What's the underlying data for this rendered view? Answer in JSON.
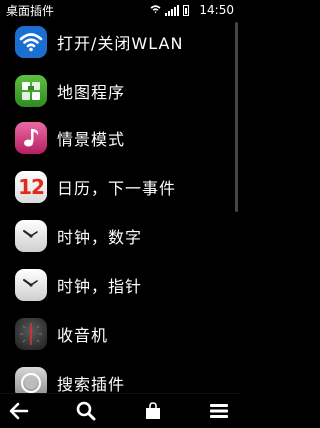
{
  "status": {
    "title": "桌面插件",
    "time": "14:50",
    "wifi_icon": "wifi-icon",
    "signal_icon": "signal-icon",
    "battery_icon": "battery-icon"
  },
  "items": [
    {
      "label": "打开/关闭WLAN",
      "icon": "wlan-icon",
      "color": "#1b6fd1"
    },
    {
      "label": "地图程序",
      "icon": "maps-icon",
      "color": "#3c9a2c"
    },
    {
      "label": "情景模式",
      "icon": "profile-music-icon",
      "color": "#c2306e"
    },
    {
      "label": "日历，下一事件",
      "icon": "calendar-icon",
      "color": "#e03a2a"
    },
    {
      "label": "时钟，数字",
      "icon": "clock-icon",
      "color": "#e8e8e8"
    },
    {
      "label": "时钟，指针",
      "icon": "clock-icon",
      "color": "#e8e8e8"
    },
    {
      "label": "收音机",
      "icon": "radio-icon",
      "color": "#3a3a3a"
    },
    {
      "label": "搜索插件",
      "icon": "search-widget-icon",
      "color": "#9a9a9a"
    }
  ],
  "calendar_day": "12",
  "toolbar": {
    "back_icon": "back-arrow-icon",
    "search_icon": "search-icon",
    "store_icon": "store-bag-icon",
    "menu_icon": "menu-icon"
  }
}
